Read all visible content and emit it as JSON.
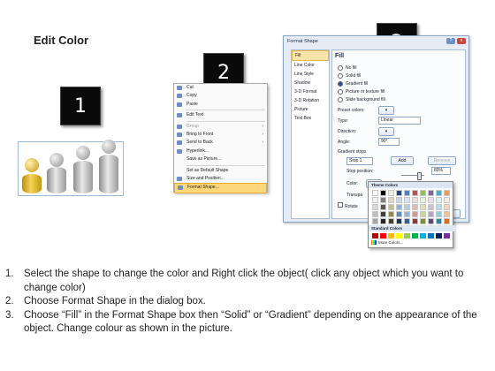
{
  "title": "Edit Color",
  "badges": [
    "1",
    "2",
    "3"
  ],
  "context_menu": {
    "items": [
      {
        "label": "Cut",
        "disabled": false,
        "submenu": false
      },
      {
        "label": "Copy",
        "disabled": false,
        "submenu": false
      },
      {
        "label": "Paste",
        "disabled": false,
        "submenu": false
      },
      {
        "label": "Edit Text",
        "disabled": false,
        "submenu": false
      },
      {
        "label": "Group",
        "disabled": true,
        "submenu": true
      },
      {
        "label": "Bring to Front",
        "disabled": false,
        "submenu": true
      },
      {
        "label": "Send to Back",
        "disabled": false,
        "submenu": true
      },
      {
        "label": "Hyperlink...",
        "disabled": false,
        "submenu": false
      },
      {
        "label": "Save as Picture...",
        "disabled": false,
        "submenu": false
      },
      {
        "label": "Set as Default Shape",
        "disabled": false,
        "submenu": false
      },
      {
        "label": "Size and Position...",
        "disabled": false,
        "submenu": false
      },
      {
        "label": "Format Shape...",
        "disabled": false,
        "submenu": false,
        "highlighted": true
      }
    ]
  },
  "dialog": {
    "title": "Format Shape",
    "help_button": "?",
    "close_x": "x",
    "nav": [
      "Fill",
      "Line Color",
      "Line Style",
      "Shadow",
      "3-D Format",
      "3-D Rotation",
      "Picture",
      "Text Box"
    ],
    "nav_selected": "Fill",
    "heading": "Fill",
    "options": [
      "No fill",
      "Solid fill",
      "Gradient fill",
      "Picture or texture fill",
      "Slide background fill"
    ],
    "option_selected": "Gradient fill",
    "preset_label": "Preset colors:",
    "type_label": "Type:",
    "type_value": "Linear",
    "direction_label": "Direction:",
    "angle_label": "Angle:",
    "angle_value": "90°",
    "stops_label": "Gradient stops",
    "stop_value": "Stop 1",
    "add_button": "Add",
    "remove_button": "Remove",
    "stop_position_label": "Stop position:",
    "stop_position_value": "89%",
    "color_label": "Color:",
    "transparency_label": "Transpa",
    "rotate_label": "Rotate",
    "close_button": "Close"
  },
  "palette": {
    "theme_heading": "Theme Colors",
    "standard_heading": "Standard Colors",
    "more": "More Colors...",
    "theme_top": [
      "#ffffff",
      "#000000",
      "#eeece1",
      "#1f497d",
      "#4f81bd",
      "#c0504d",
      "#9bbb59",
      "#8064a2",
      "#4bacc6",
      "#f79646"
    ],
    "theme_rows": [
      [
        "#f2f2f2",
        "#7f7f7f",
        "#ddd9c3",
        "#c6d9f0",
        "#dbe5f1",
        "#f2dcdb",
        "#ebf1dd",
        "#e5e0ec",
        "#dbeef3",
        "#fdeada"
      ],
      [
        "#d8d8d8",
        "#595959",
        "#c4bd97",
        "#8db3e2",
        "#b8cce4",
        "#e5b9b7",
        "#d7e3bc",
        "#ccc1d9",
        "#b7dde8",
        "#fbd5b5"
      ],
      [
        "#bfbfbf",
        "#3f3f3f",
        "#938953",
        "#548dd4",
        "#95b3d7",
        "#d99694",
        "#c3d69b",
        "#b2a2c7",
        "#92cddc",
        "#fac08f"
      ],
      [
        "#a5a5a5",
        "#262626",
        "#494429",
        "#17365d",
        "#366092",
        "#953734",
        "#76923c",
        "#5f497a",
        "#31859b",
        "#e36c09"
      ],
      [
        "#7f7f7f",
        "#0c0c0c",
        "#1d1b10",
        "#0f243e",
        "#244061",
        "#632423",
        "#4f6128",
        "#3f3151",
        "#205867",
        "#974806"
      ]
    ],
    "standard": [
      "#c00000",
      "#ff0000",
      "#ffc000",
      "#ffff00",
      "#92d050",
      "#00b050",
      "#00b0f0",
      "#0070c0",
      "#002060",
      "#7030a0"
    ]
  },
  "steps": [
    {
      "num": "1.",
      "text": "Select the shape to change the color and Right click the object( click any object which you want to change color)"
    },
    {
      "num": "2.",
      "text": "Choose Format Shape in the dialog box."
    },
    {
      "num": "3.",
      "text": "Choose “Fill” in the Format Shape box then “Solid” or “Gradient” depending on the appearance of the object. Change colour as shown in the picture."
    }
  ],
  "colors": {
    "badge": "#0a0a0a",
    "highlight": "#fcd77a",
    "gold": "#f8d45a",
    "dialog_bg": "#e5ecf5"
  }
}
